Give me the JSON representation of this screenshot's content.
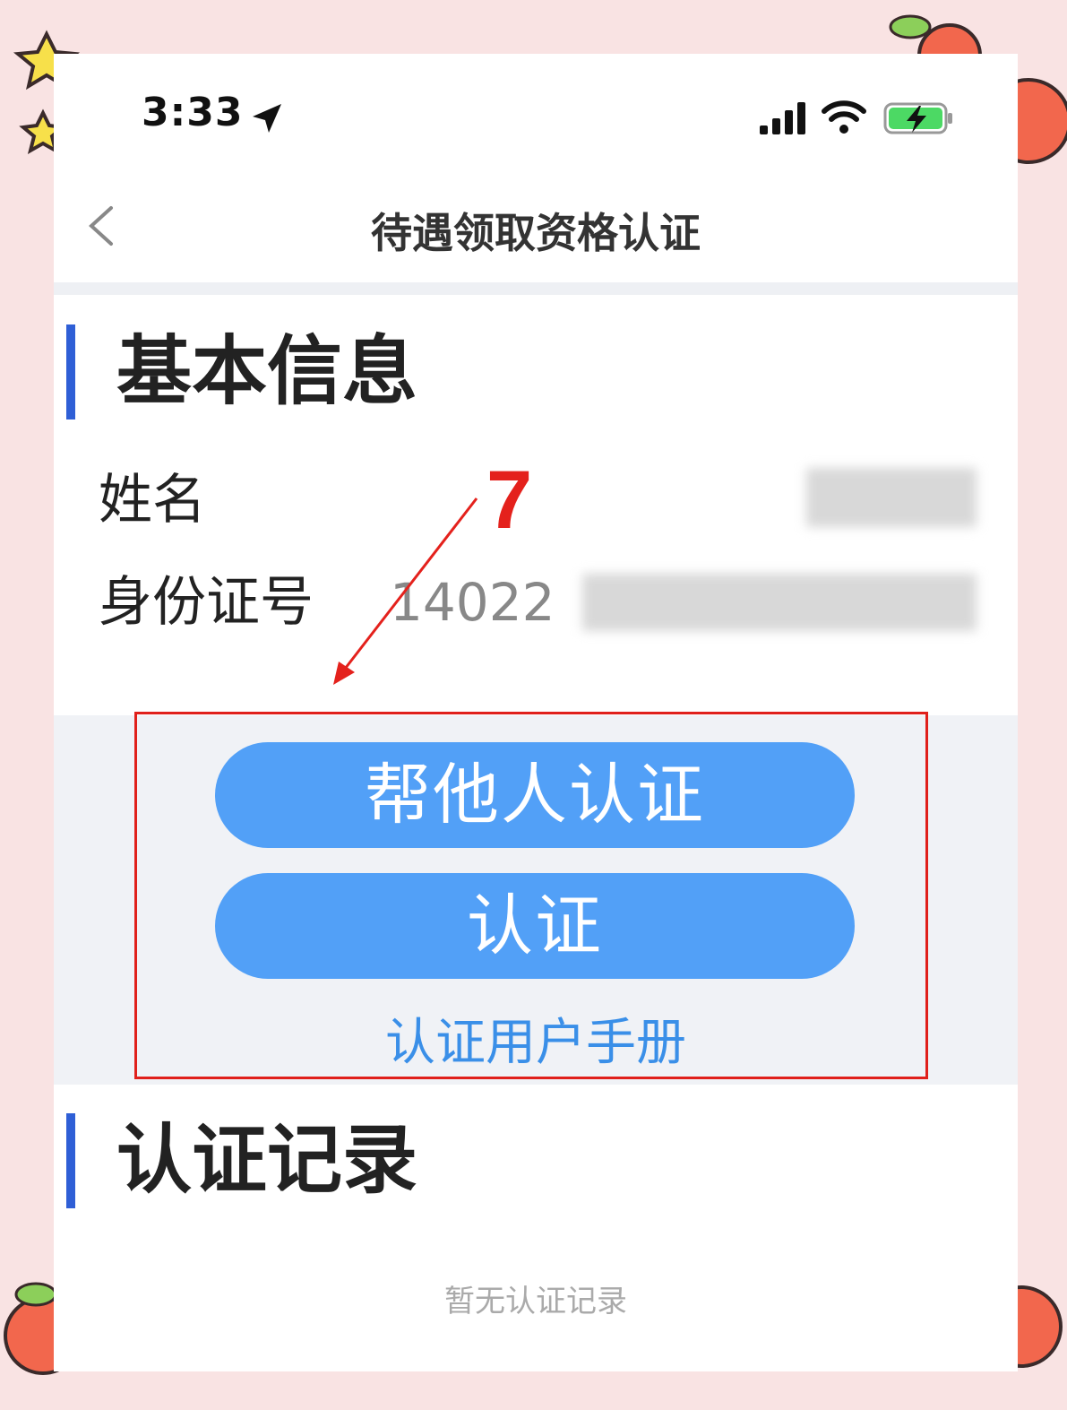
{
  "status_bar": {
    "time": "3:33",
    "icons": [
      "location-arrow-icon",
      "signal-icon",
      "wifi-icon",
      "battery-charging-icon"
    ]
  },
  "nav": {
    "back_icon": "chevron-left-icon",
    "title": "待遇领取资格认证"
  },
  "basic_info": {
    "title": "基本信息",
    "name_label": "姓名",
    "id_label": "身份证号",
    "id_value_visible": "14022"
  },
  "actions": {
    "help_others_label": "帮他人认证",
    "certify_label": "认证",
    "manual_link": "认证用户手册"
  },
  "records": {
    "title": "认证记录",
    "empty_text": "暂无认证记录"
  },
  "annotation": {
    "step_number": "7",
    "color": "#e4211c"
  },
  "colors": {
    "accent_bar": "#2f5fd6",
    "button": "#52a0f7",
    "link": "#3a8fe8",
    "panel_bg": "#f0f2f6"
  }
}
